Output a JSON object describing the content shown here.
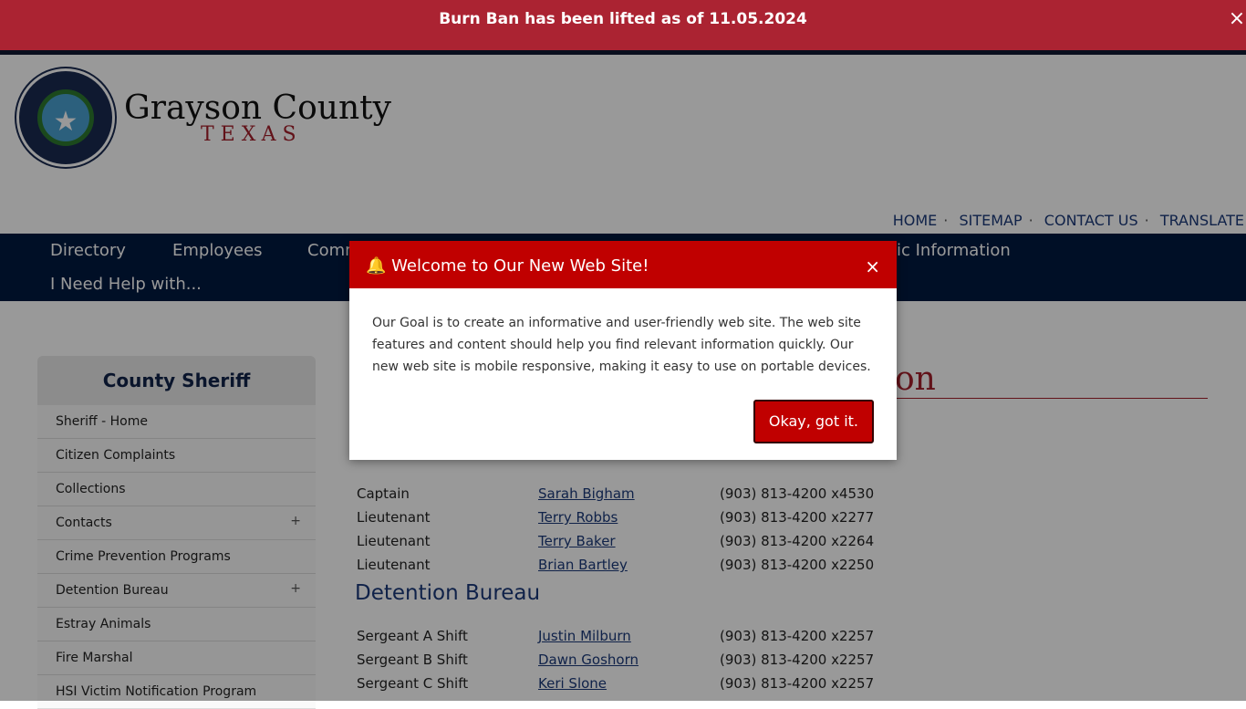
{
  "banner": {
    "text": "Burn Ban has been lifted as of 11.05.2024",
    "close": "×"
  },
  "logo": {
    "name": "Grayson County",
    "state": "TEXAS",
    "seal_text": "GRAYSON COUNTY, TEXAS Est. 1846"
  },
  "utility": [
    "HOME",
    "SITEMAP",
    "CONTACT US",
    "TRANSLATE"
  ],
  "nav": [
    "Directory",
    "Employees",
    "Comm",
    "ic Information",
    "I Need Help with..."
  ],
  "sidebar": {
    "title": "County Sheriff",
    "items": [
      {
        "label": "Sheriff - Home",
        "plus": ""
      },
      {
        "label": "Citizen Complaints",
        "plus": ""
      },
      {
        "label": "Collections",
        "plus": ""
      },
      {
        "label": "Contacts",
        "plus": "+"
      },
      {
        "label": "Crime Prevention Programs",
        "plus": ""
      },
      {
        "label": "Detention Bureau",
        "plus": "+"
      },
      {
        "label": "Estray Animals",
        "plus": ""
      },
      {
        "label": "Fire Marshal",
        "plus": ""
      },
      {
        "label": "HSI Victim Notification Program",
        "plus": ""
      }
    ]
  },
  "main": {
    "title_fragment": "tion",
    "rows1": [
      {
        "role": "Captain",
        "name": "Sarah Bigham",
        "phone": "(903) 813-4200 x4530"
      },
      {
        "role": "Lieutenant",
        "name": "Terry Robbs",
        "phone": "(903) 813-4200 x2277"
      },
      {
        "role": "Lieutenant",
        "name": "Terry Baker",
        "phone": "(903) 813-4200 x2264"
      },
      {
        "role": "Lieutenant",
        "name": "Brian Bartley",
        "phone": "(903) 813-4200 x2250"
      }
    ],
    "section2": "Detention Bureau",
    "rows2": [
      {
        "role": "Sergeant A Shift",
        "name": "Justin Milburn",
        "phone": "(903) 813-4200 x2257"
      },
      {
        "role": "Sergeant B Shift",
        "name": "Dawn Goshorn",
        "phone": "(903) 813-4200 x2257"
      },
      {
        "role": "Sergeant C Shift",
        "name": "Keri Slone",
        "phone": "(903) 813-4200 x2257"
      }
    ]
  },
  "modal": {
    "title": "Welcome to Our New Web Site!",
    "close": "×",
    "body": "Our Goal is to create an informative and user-friendly web site.  The web site features and content should help you find relevant information quickly.  Our new web site is mobile responsive, making it easy to use on portable devices.",
    "button": "Okay, got it."
  },
  "colors": {
    "banner": "#ab2332",
    "nav": "#001a40",
    "modal_header": "#c00000",
    "link": "#1b3a7a"
  }
}
